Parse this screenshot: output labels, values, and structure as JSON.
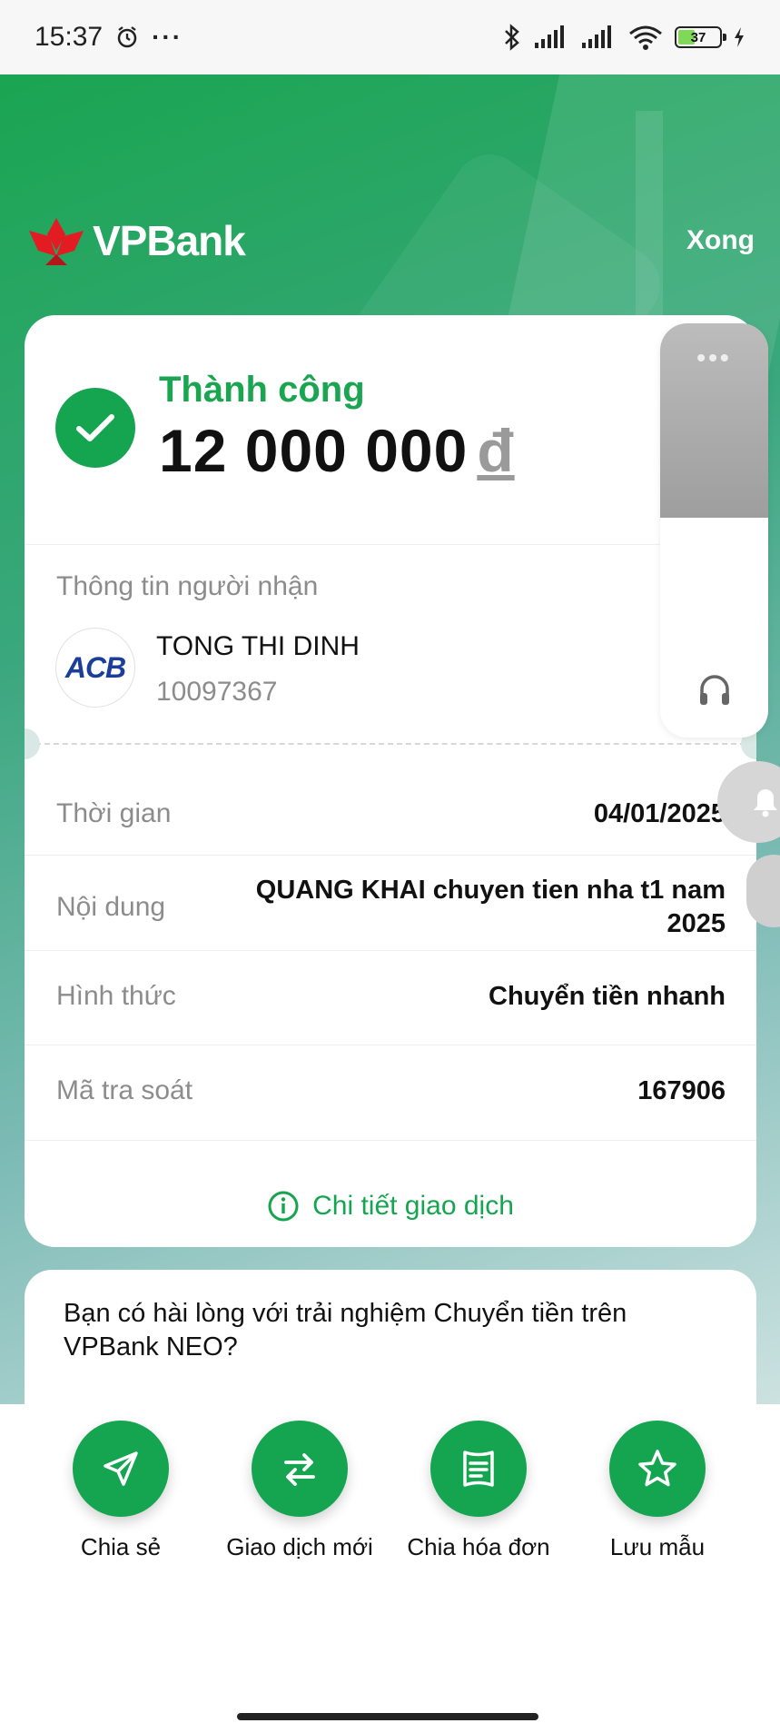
{
  "status_bar": {
    "time": "15:37",
    "more": "···",
    "battery": "37"
  },
  "header": {
    "brand": "VPBank",
    "done_label": "Xong"
  },
  "result": {
    "status": "Thành công",
    "amount": "12 000 000",
    "currency": "đ"
  },
  "recipient": {
    "section_label": "Thông tin người nhận",
    "bank_logo_text": "ACB",
    "name": "TONG THI DINH",
    "account": "10097367"
  },
  "details": [
    {
      "label": "Thời gian",
      "value": "04/01/2025"
    },
    {
      "label": "Nội dung",
      "value_line1": "QUANG KHAI chuyen tien nha t1 nam",
      "value_line2": "2025"
    },
    {
      "label": "Hình thức",
      "value": "Chuyển tiền nhanh"
    },
    {
      "label": "Mã tra soát",
      "value": "167906"
    }
  ],
  "detail_link": "Chi tiết giao dịch",
  "survey": {
    "question": "Bạn có hài lòng với trải nghiệm Chuyển tiền trên VPBank NEO?"
  },
  "actions": [
    {
      "label": "Chia sẻ",
      "icon": "send-icon"
    },
    {
      "label": "Giao dịch mới",
      "icon": "swap-icon"
    },
    {
      "label": "Chia hóa đơn",
      "icon": "receipt-icon"
    },
    {
      "label": "Lưu mẫu",
      "icon": "star-icon"
    }
  ],
  "colors": {
    "primary_green": "#15a550",
    "brand_red": "#e31c23",
    "acb_blue": "#1b3f99"
  }
}
